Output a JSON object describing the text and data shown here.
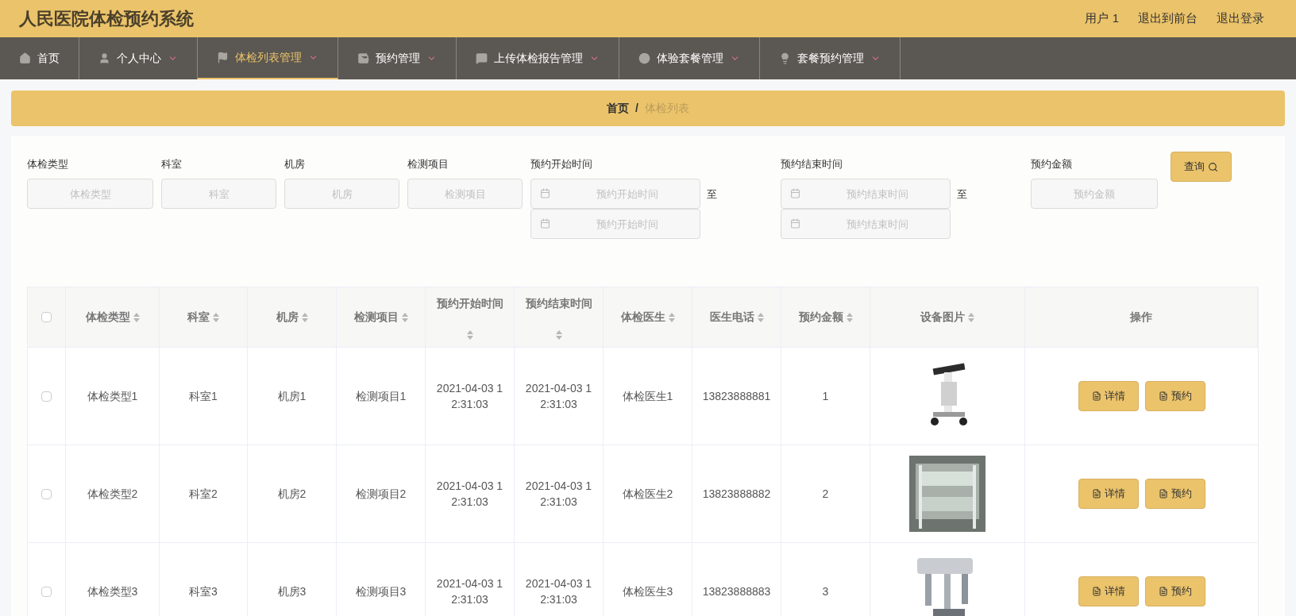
{
  "header": {
    "title": "人民医院体检预约系统",
    "links": [
      "用户 1",
      "退出到前台",
      "退出登录"
    ]
  },
  "nav": [
    {
      "label": "首页",
      "dropdown": false,
      "selected": false
    },
    {
      "label": "个人中心",
      "dropdown": true,
      "selected": false
    },
    {
      "label": "体检列表管理",
      "dropdown": true,
      "selected": true
    },
    {
      "label": "预约管理",
      "dropdown": true,
      "selected": false
    },
    {
      "label": "上传体检报告管理",
      "dropdown": true,
      "selected": false
    },
    {
      "label": "体验套餐管理",
      "dropdown": true,
      "selected": false
    },
    {
      "label": "套餐预约管理",
      "dropdown": true,
      "selected": false
    }
  ],
  "breadcrumb": [
    "首页",
    "/",
    "体检列表"
  ],
  "filters": [
    {
      "kind": "text",
      "label": "体检类型",
      "placeholder": "体检类型"
    },
    {
      "kind": "text",
      "label": "科室",
      "placeholder": "科室"
    },
    {
      "kind": "text",
      "label": "机房",
      "placeholder": "机房"
    },
    {
      "kind": "text",
      "label": "检测项目",
      "placeholder": "检测项目"
    },
    {
      "kind": "daterange",
      "label": "预约开始时间",
      "placeholder": "预约开始时间",
      "placeholder_end": "预约开始时间",
      "separator": "至"
    },
    {
      "kind": "daterange",
      "label": "预约结束时间",
      "placeholder": "预约结束时间",
      "placeholder_end": "预约结束时间",
      "separator": "至"
    },
    {
      "kind": "text",
      "label": "预约金额",
      "placeholder": "预约金额"
    }
  ],
  "search_button": "查询",
  "table": {
    "all_checked": false,
    "columns": [
      {
        "label": "体检类型",
        "sortable": true
      },
      {
        "label": "科室",
        "sortable": true
      },
      {
        "label": "机房",
        "sortable": true
      },
      {
        "label": "检测项目",
        "sortable": true
      },
      {
        "label": "预约开始时间",
        "sortable": true
      },
      {
        "label": "预约结束时间",
        "sortable": true
      },
      {
        "label": "体检医生",
        "sortable": true
      },
      {
        "label": "医生电话",
        "sortable": true
      },
      {
        "label": "预约金额",
        "sortable": true
      },
      {
        "label": "设备图片",
        "sortable": true
      },
      {
        "label": "操作",
        "sortable": false
      }
    ],
    "rows": [
      {
        "checked": false,
        "cells": [
          "体检类型1",
          "科室1",
          "机房1",
          "检测项目1",
          "2021-04-03 12:31:03",
          "2021-04-03 12:31:03",
          "体检医生1",
          "13823888881",
          "1"
        ],
        "image": {
          "kind": "picture"
        },
        "actions": [
          "详情",
          "预约"
        ]
      },
      {
        "checked": false,
        "cells": [
          "体检类型2",
          "科室2",
          "机房2",
          "检测项目2",
          "2021-04-03 12:31:03",
          "2021-04-03 12:31:03",
          "体检医生2",
          "13823888882",
          "2"
        ],
        "image": {
          "kind": "picture"
        },
        "actions": [
          "详情",
          "预约"
        ]
      },
      {
        "checked": false,
        "cells": [
          "体检类型3",
          "科室3",
          "机房3",
          "检测项目3",
          "2021-04-03 12:31:03",
          "2021-04-03 12:31:03",
          "体检医生3",
          "13823888883",
          "3"
        ],
        "image": {
          "kind": "picture"
        },
        "actions": [
          "详情",
          "预约"
        ]
      }
    ]
  }
}
